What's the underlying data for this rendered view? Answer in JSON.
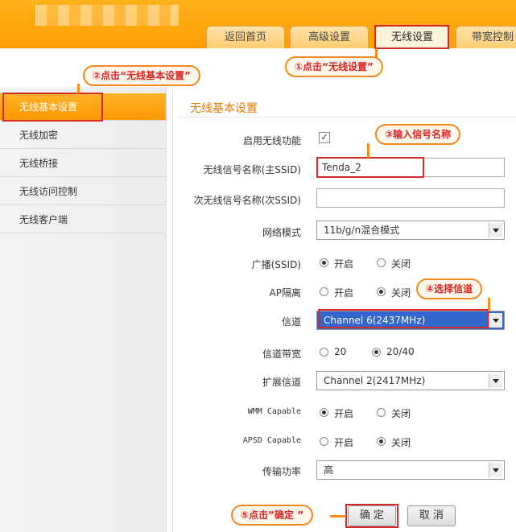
{
  "tabs": [
    "返回首页",
    "高级设置",
    "无线设置",
    "带宽控制"
  ],
  "sidebar": {
    "items": [
      "无线基本设置",
      "无线加密",
      "无线桥接",
      "无线访问控制",
      "无线客户端"
    ]
  },
  "main": {
    "title": "无线基本设置",
    "enable_label": "启用无线功能",
    "enable_check": "✓",
    "ssid_label": "无线信号名称(主SSID)",
    "ssid_value": "Tenda_2",
    "ssid2_label": "次无线信号名称(次SSID)",
    "ssid2_value": "",
    "mode_label": "网络模式",
    "mode_value": "11b/g/n混合模式",
    "broadcast_label": "广播(SSID)",
    "ap_label": "AP隔离",
    "on": "开启",
    "off": "关闭",
    "channel_label": "信道",
    "channel_value": "Channel 6(2437MHz)",
    "bandwidth_label": "信道带宽",
    "bw20": "20",
    "bw40": "20/40",
    "ext_label": "扩展信道",
    "ext_value": "Channel 2(2417MHz)",
    "wmm_label": "WMM Capable",
    "apsd_label": "APSD Capable",
    "power_label": "传输功率",
    "power_value": "高",
    "ok": "确 定",
    "cancel": "取 消"
  },
  "callouts": {
    "c1": "①点击“无线设置”",
    "c2": "②点击“无线基本设置”",
    "c3": "③输入信号名称",
    "c4": "④选择信道",
    "c5": "⑤点击”确定 ”"
  },
  "colors": {
    "accent": "#ff9a00",
    "highlight_red": "#d42a2a",
    "callout_border": "#f08a20"
  }
}
